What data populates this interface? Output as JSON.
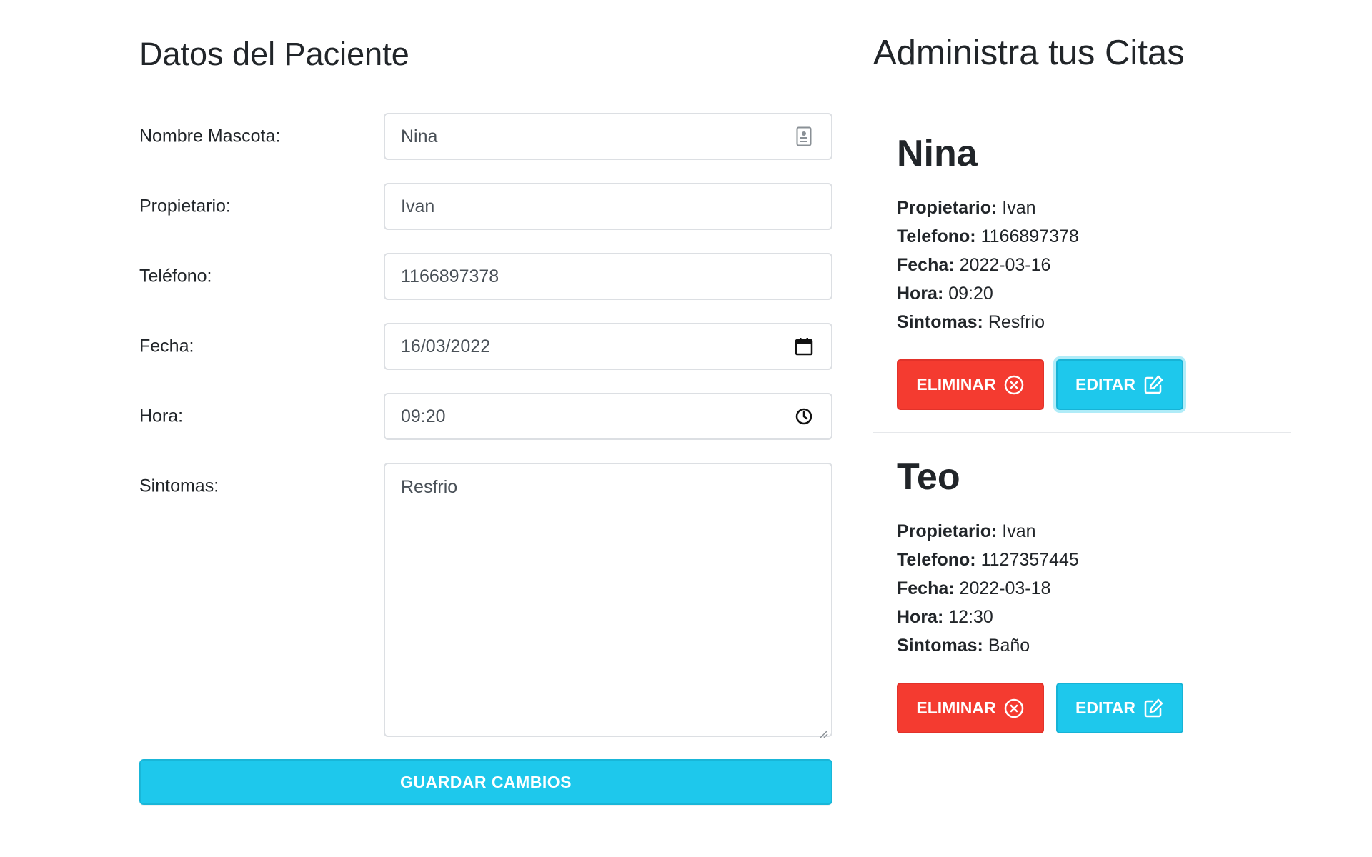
{
  "form": {
    "title": "Datos del Paciente",
    "fields": [
      {
        "label": "Nombre Mascota:",
        "value": "Nina",
        "icon": "contact-card-icon"
      },
      {
        "label": "Propietario:",
        "value": "Ivan"
      },
      {
        "label": "Teléfono:",
        "value": "1166897378"
      },
      {
        "label": "Fecha:",
        "value": "16/03/2022",
        "icon": "calendar-icon"
      },
      {
        "label": "Hora:",
        "value": "09:20",
        "icon": "clock-icon"
      },
      {
        "label": "Sintomas:",
        "value": "Resfrio"
      }
    ],
    "save_label": "GUARDAR CAMBIOS"
  },
  "list": {
    "title": "Administra tus Citas",
    "keys": {
      "owner": "Propietario:",
      "phone": "Telefono:",
      "date": "Fecha:",
      "time": "Hora:",
      "symptoms": "Sintomas:"
    },
    "delete_label": "ELIMINAR",
    "edit_label": "EDITAR",
    "citas": [
      {
        "name": "Nina",
        "owner": "Ivan",
        "phone": "1166897378",
        "date": "2022-03-16",
        "time": "09:20",
        "symptoms": "Resfrio"
      },
      {
        "name": "Teo",
        "owner": "Ivan",
        "phone": "1127357445",
        "date": "2022-03-18",
        "time": "12:30",
        "symptoms": "Baño"
      }
    ]
  },
  "colors": {
    "danger": "#f43b30",
    "info": "#1ec8ec",
    "text": "#212529",
    "border": "#dcdfe3"
  }
}
